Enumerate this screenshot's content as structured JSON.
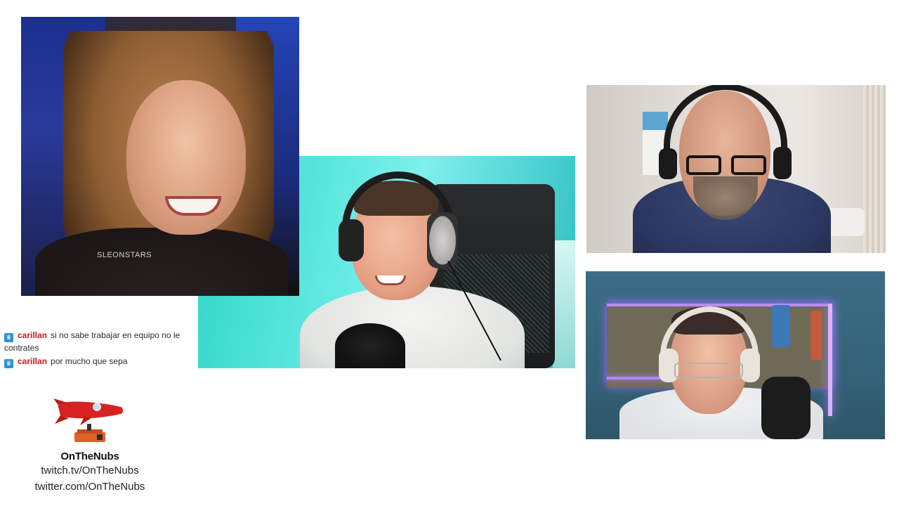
{
  "cameras": {
    "clip": {
      "watermark": "SLEONSTARS"
    },
    "host": {},
    "guest1": {},
    "guest2": {}
  },
  "chat": {
    "messages": [
      {
        "badge_icon": "crown-badge-icon",
        "user": "carillan",
        "text": "si no sabe trabajar en equipo no le contrates"
      },
      {
        "badge_icon": "crown-badge-icon",
        "user": "carillan",
        "text": "por mucho que sepa"
      }
    ],
    "colors": {
      "user": "#c81a1a",
      "badge": "#2a94d6"
    }
  },
  "brand": {
    "logo_icon": "rocket-logo-icon",
    "name": "OnTheNubs",
    "twitch": "twitch.tv/OnTheNubs",
    "twitter": "twitter.com/OnTheNubs",
    "colors": {
      "rocket": "#d6231f",
      "base": "#e0612a"
    }
  }
}
